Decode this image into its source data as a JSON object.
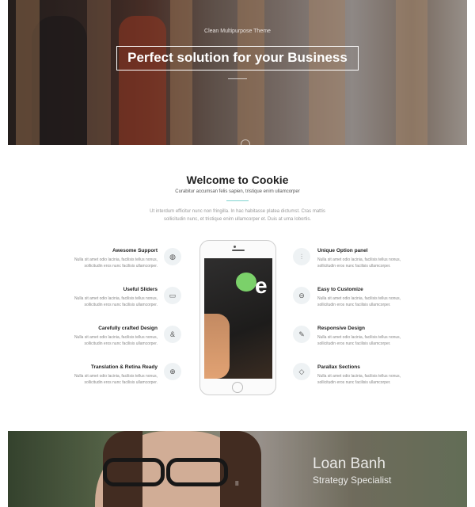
{
  "hero": {
    "subtitle": "Clean Multipurpose Theme",
    "title": "Perfect solution for your Business"
  },
  "welcome": {
    "title": "Welcome to Cookie",
    "subtitle": "Curabitur accumsan felis sapien, tristique enim ullamcorper",
    "description": "Ut interdum efficitur nunc non fringilla. In hac habitasse platea dictumst. Cras mattis sollicitudin nunc, et tristique enim ullamcorper et. Duis at urna lobortis."
  },
  "features": {
    "left": [
      {
        "title": "Awesome Support",
        "text": "Nulla sit amet odio lacinia, facilisis tellus nonus, sollicitudin eros nunc facilisis ullamcorper.",
        "icon": "globe-icon",
        "glyph": "◍"
      },
      {
        "title": "Useful Sliders",
        "text": "Nulla sit amet odio lacinia, facilisis tellus nonus, sollicitudin eros nunc facilisis ullamcorper.",
        "icon": "window-icon",
        "glyph": "▭"
      },
      {
        "title": "Carefully crafted Design",
        "text": "Nulla sit amet odio lacinia, facilisis tellus nonus, sollicitudin eros nunc facilisis ullamcorper.",
        "icon": "swirl-icon",
        "glyph": "&"
      },
      {
        "title": "Translation & Retina Ready",
        "text": "Nulla sit amet odio lacinia, facilisis tellus nonus, sollicitudin eros nunc facilisis ullamcorper.",
        "icon": "world-icon",
        "glyph": "⊕"
      }
    ],
    "right": [
      {
        "title": "Unique Option panel",
        "text": "Nulla sit amet odio lacinia, facilisis tellus nonus, sollicitudin eros nunc facilisis ullamcorper.",
        "icon": "sliders-icon",
        "glyph": "⫶"
      },
      {
        "title": "Easy to Customize",
        "text": "Nulla sit amet odio lacinia, facilisis tellus nonus, sollicitudin eros nunc facilisis ullamcorper.",
        "icon": "toggle-icon",
        "glyph": "⊖"
      },
      {
        "title": "Responsive Design",
        "text": "Nulla sit amet odio lacinia, facilisis tellus nonus, sollicitudin eros nunc facilisis ullamcorper.",
        "icon": "pen-icon",
        "glyph": "✎"
      },
      {
        "title": "Parallax Sections",
        "text": "Nulla sit amet odio lacinia, facilisis tellus nonus, sollicitudin eros nunc facilisis ullamcorper.",
        "icon": "diamond-icon",
        "glyph": "◇"
      }
    ]
  },
  "phone": {
    "screen_letter": "e"
  },
  "team": {
    "name": "Loan Banh",
    "role": "Strategy Specialist",
    "pause_glyph": "II"
  },
  "colors": {
    "accent": "#7fd4d0"
  }
}
